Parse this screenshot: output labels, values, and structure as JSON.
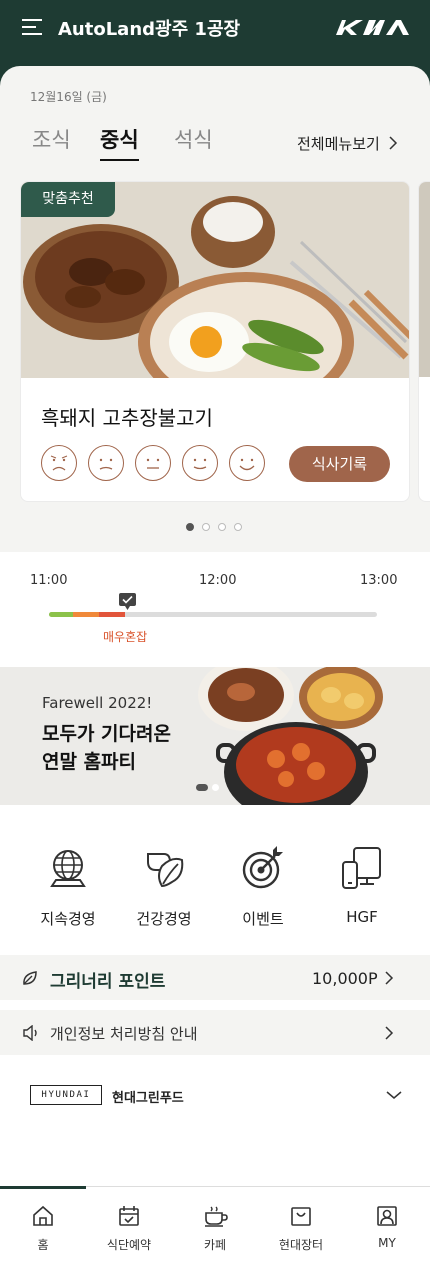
{
  "header": {
    "title": "AutoLand광주 1공장",
    "brand": "KIA"
  },
  "meal": {
    "date": "12월16일 (금)",
    "tabs": [
      "조식",
      "중식",
      "석식"
    ],
    "active_tab": "중식",
    "all_menu_label": "전체메뉴보기",
    "card": {
      "badge": "맞춤추천",
      "dish": "흑돼지 고추장불고기",
      "ratings": [
        "very-bad",
        "bad",
        "neutral",
        "good",
        "very-good"
      ],
      "record_button": "식사기록"
    },
    "carousel_pages": 4,
    "carousel_active": 1
  },
  "crowd": {
    "times": [
      "11:00",
      "12:00",
      "13:00"
    ],
    "status": "매우혼잡",
    "colors": {
      "low": "#8cc24a",
      "mid": "#f0893a",
      "high": "#e2553b",
      "track": "#dcdcdc"
    }
  },
  "banner": {
    "subtitle": "Farewell 2022!",
    "title_line1": "모두가 기다려온",
    "title_line2": "연말 홈파티",
    "pages": 2,
    "active": 1
  },
  "quick_menu": [
    {
      "label": "지속경영",
      "icon": "globe-icon"
    },
    {
      "label": "건강경영",
      "icon": "leaf-icon"
    },
    {
      "label": "이벤트",
      "icon": "target-icon"
    },
    {
      "label": "HGF",
      "icon": "devices-icon"
    }
  ],
  "points": {
    "title": "그리너리 포인트",
    "value": "10,000P"
  },
  "privacy": {
    "text": "개인정보 처리방침 안내"
  },
  "footer": {
    "logo_text": "HYUNDAI",
    "company": "현대그린푸드"
  },
  "tabs": [
    {
      "label": "홈",
      "icon": "home-icon"
    },
    {
      "label": "식단예약",
      "icon": "calendar-icon"
    },
    {
      "label": "카페",
      "icon": "coffee-icon"
    },
    {
      "label": "현대장터",
      "icon": "shopping-bag-icon"
    },
    {
      "label": "MY",
      "icon": "user-icon"
    }
  ],
  "colors": {
    "brand_green": "#1e3b33",
    "accent_brown": "#a0654b",
    "badge_green": "#2f5a4b"
  }
}
